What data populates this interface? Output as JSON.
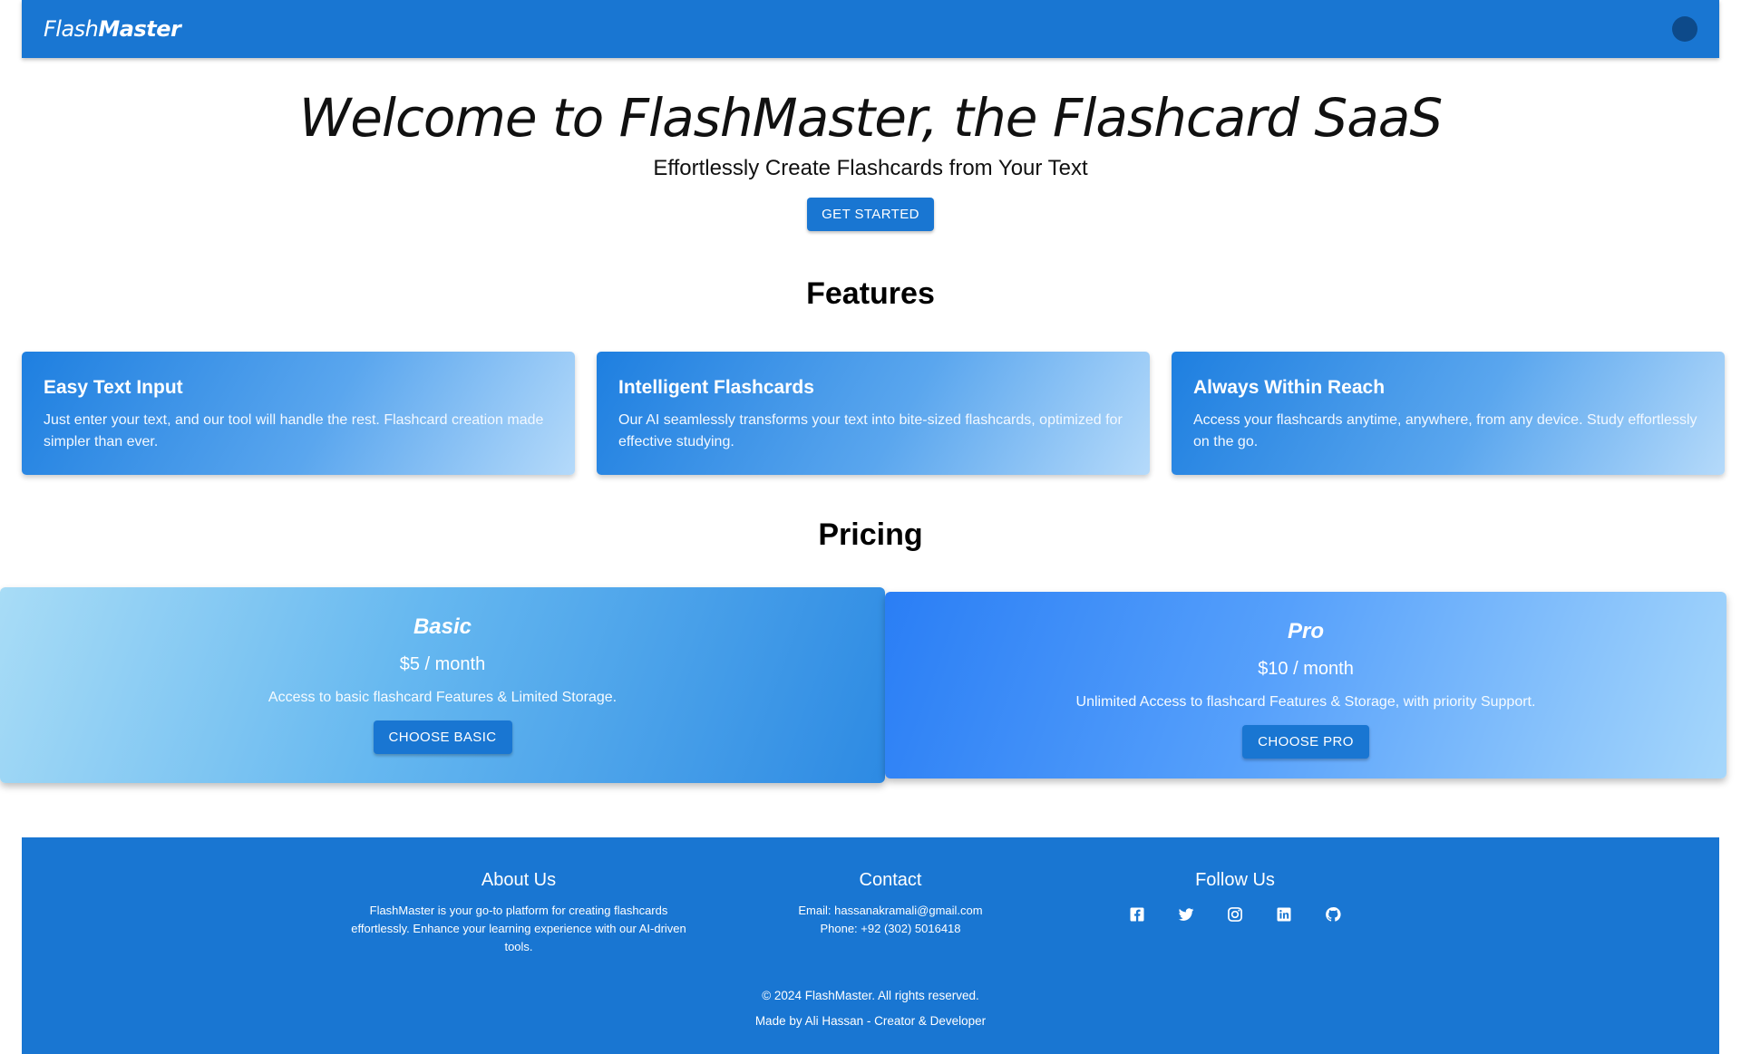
{
  "header": {
    "logo_part1": "Flash",
    "logo_part2": "Master"
  },
  "hero": {
    "title": "Welcome to FlashMaster, the Flashcard SaaS",
    "subtitle": "Effortlessly Create Flashcards from Your Text",
    "cta_label": "GET STARTED"
  },
  "features": {
    "title": "Features",
    "items": [
      {
        "title": "Easy Text Input",
        "text": "Just enter your text, and our tool will handle the rest. Flashcard creation made simpler than ever."
      },
      {
        "title": "Intelligent Flashcards",
        "text": "Our AI seamlessly transforms your text into bite-sized flashcards, optimized for effective studying."
      },
      {
        "title": "Always Within Reach",
        "text": "Access your flashcards anytime, anywhere, from any device. Study effortlessly on the go."
      }
    ]
  },
  "pricing": {
    "title": "Pricing",
    "plans": [
      {
        "name": "Basic",
        "price": "$5 / month",
        "description": "Access to basic flashcard Features & Limited Storage.",
        "button": "CHOOSE BASIC"
      },
      {
        "name": "Pro",
        "price": "$10 / month",
        "description": "Unlimited Access to flashcard Features & Storage, with priority Support.",
        "button": "CHOOSE PRO"
      }
    ]
  },
  "footer": {
    "about": {
      "title": "About Us",
      "text": "FlashMaster is your go-to platform for creating flashcards effortlessly. Enhance your learning experience with our AI-driven tools."
    },
    "contact": {
      "title": "Contact",
      "email": "Email: hassanakramali@gmail.com",
      "phone": "Phone: +92 (302) 5016418"
    },
    "follow": {
      "title": "Follow Us",
      "icons": [
        "facebook-icon",
        "twitter-icon",
        "instagram-icon",
        "linkedin-icon",
        "github-icon"
      ]
    },
    "copyright": "© 2024 FlashMaster. All rights reserved.",
    "made_by": "Made by Ali Hassan - Creator & Developer"
  },
  "colors": {
    "primary": "#1976d2",
    "avatar": "#0d4a8a"
  }
}
